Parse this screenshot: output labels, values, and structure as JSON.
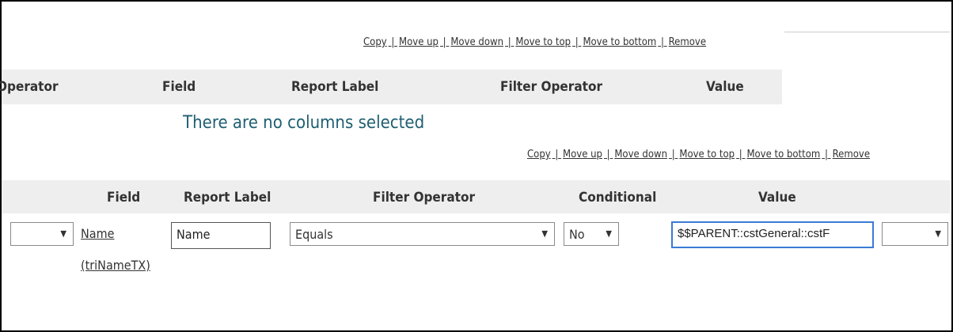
{
  "top_section": {
    "actions": [
      "Copy",
      "Move up",
      "Move down",
      "Move to top",
      "Move to bottom",
      "Remove"
    ],
    "headers": {
      "operator": "Operator",
      "field": "Field",
      "report_label": "Report Label",
      "filter_operator": "Filter Operator",
      "value": "Value"
    },
    "empty_message": "There are no columns selected"
  },
  "bottom_section": {
    "actions": [
      "Copy",
      "Move up",
      "Move down",
      "Move to top",
      "Move to bottom",
      "Remove"
    ],
    "headers": {
      "field": "Field",
      "report_label": "Report Label",
      "filter_operator": "Filter Operator",
      "conditional": "Conditional",
      "value": "Value"
    },
    "row": {
      "operator_select": "",
      "field_link_name": "Name",
      "field_link_id": "(triNameTX)",
      "report_label_value": "Name",
      "filter_operator_select": "Equals",
      "conditional_select": "No",
      "value_input": "$$PARENT::cstGeneral::cstF",
      "trailing_select": ""
    }
  },
  "icons": {
    "dropdown_arrow": "▼"
  }
}
